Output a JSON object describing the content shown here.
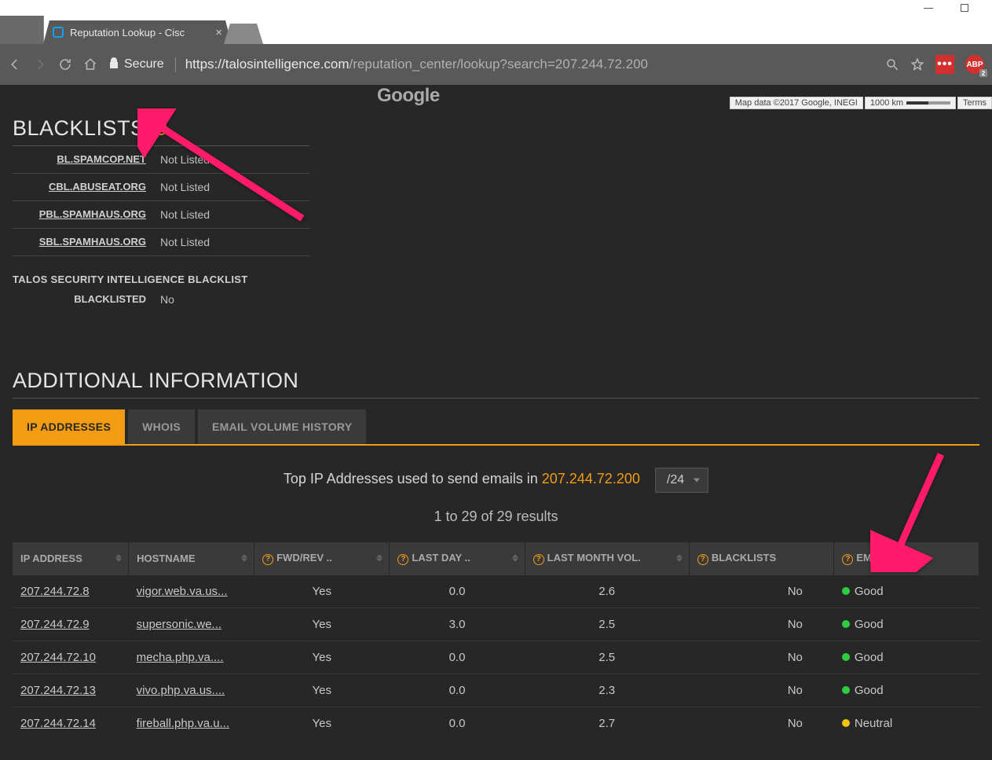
{
  "browser": {
    "tab_title": "Reputation Lookup - Cisc",
    "secure_label": "Secure",
    "url_proto": "https://",
    "url_domain": "talosintelligence.com",
    "url_path": "/reputation_center/lookup?search=207.244.72.200",
    "abp_badge": "2"
  },
  "map": {
    "wordmark": "Google",
    "credits": "Map data ©2017 Google, INEGI",
    "scale": "1000 km",
    "terms": "Terms"
  },
  "blacklists": {
    "title": "BLACKLISTS",
    "rows": [
      {
        "label": "BL.SPAMCOP.NET",
        "value": "Not Listed"
      },
      {
        "label": "CBL.ABUSEAT.ORG",
        "value": "Not Listed"
      },
      {
        "label": "PBL.SPAMHAUS.ORG",
        "value": "Not Listed"
      },
      {
        "label": "SBL.SPAMHAUS.ORG",
        "value": "Not Listed"
      }
    ],
    "talos_title": "TALOS SECURITY INTELLIGENCE BLACKLIST",
    "talos_label": "BLACKLISTED",
    "talos_value": "No"
  },
  "addinfo": {
    "title": "ADDITIONAL INFORMATION",
    "tabs": [
      {
        "label": "IP ADDRESSES",
        "active": true
      },
      {
        "label": "WHOIS",
        "active": false
      },
      {
        "label": "EMAIL VOLUME HISTORY",
        "active": false
      }
    ],
    "desc_prefix": "Top IP Addresses used to send emails in ",
    "desc_ip": "207.244.72.200",
    "cidr": "/24",
    "result_count": "1 to 29 of 29 results",
    "columns": [
      "IP ADDRESS",
      "HOSTNAME",
      "FWD/REV ..",
      "LAST DAY ..",
      "LAST MONTH VOL.",
      "BLACKLISTS",
      "EMAIL REP."
    ],
    "rows": [
      {
        "ip": "207.244.72.8",
        "host": "vigor.web.va.us...",
        "fwd": "Yes",
        "lastday": "0.0",
        "lastmonth": "2.6",
        "bl": "No",
        "rep": "Good",
        "repclass": "good"
      },
      {
        "ip": "207.244.72.9",
        "host": "supersonic.we...",
        "fwd": "Yes",
        "lastday": "3.0",
        "lastmonth": "2.5",
        "bl": "No",
        "rep": "Good",
        "repclass": "good"
      },
      {
        "ip": "207.244.72.10",
        "host": "mecha.php.va....",
        "fwd": "Yes",
        "lastday": "0.0",
        "lastmonth": "2.5",
        "bl": "No",
        "rep": "Good",
        "repclass": "good"
      },
      {
        "ip": "207.244.72.13",
        "host": "vivo.php.va.us....",
        "fwd": "Yes",
        "lastday": "0.0",
        "lastmonth": "2.3",
        "bl": "No",
        "rep": "Good",
        "repclass": "good"
      },
      {
        "ip": "207.244.72.14",
        "host": "fireball.php.va.u...",
        "fwd": "Yes",
        "lastday": "0.0",
        "lastmonth": "2.7",
        "bl": "No",
        "rep": "Neutral",
        "repclass": "neutral"
      }
    ]
  }
}
